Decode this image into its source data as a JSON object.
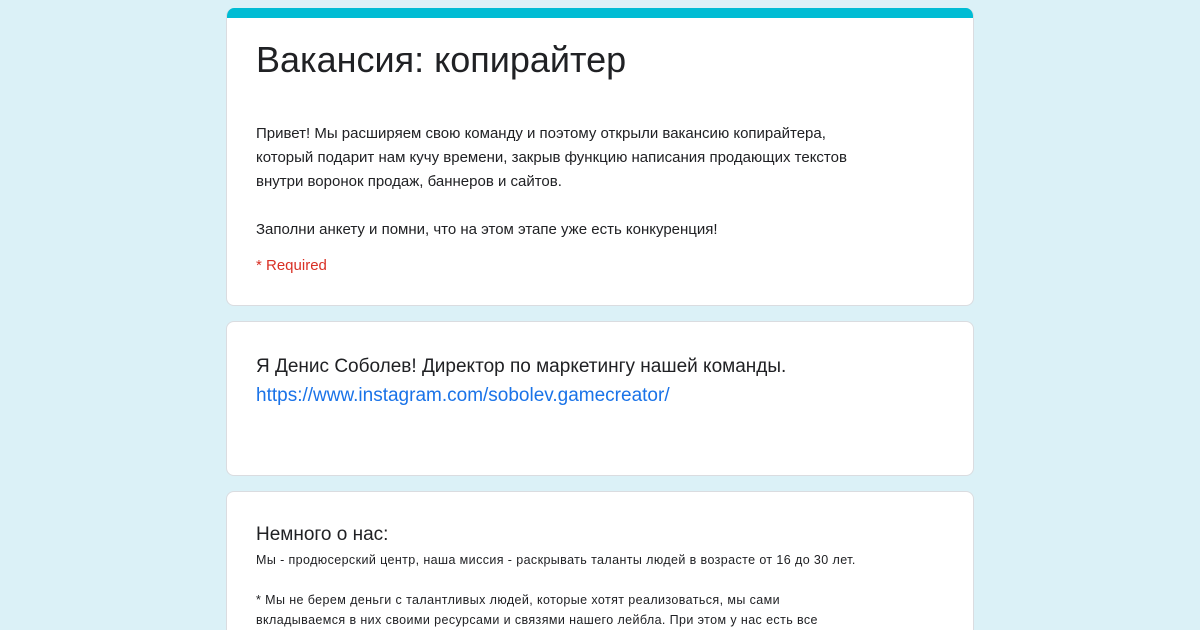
{
  "header": {
    "title": "Вакансия: копирайтер",
    "description": "Привет! Мы расширяем свою команду и поэтому открыли вакансию копирайтера,\nкоторый подарит нам кучу времени, закрыв функцию написания продающих текстов\nвнутри воронок продаж, баннеров и сайтов.\n\nЗаполни анкету и помни, что на этом этапе уже есть конкуренция!",
    "required_note": "* Required"
  },
  "intro": {
    "text": "Я Денис Соболев! Директор по маркетингу нашей команды.",
    "link": "https://www.instagram.com/sobolev.gamecreator/"
  },
  "about": {
    "heading": "Немного о нас:",
    "text": "Мы - продюсерский центр, наша миссия - раскрывать таланты людей в возрасте от 16 до 30 лет.\n\n* Мы не берем деньги с талантливых людей, которые хотят реализоваться, мы сами\nвкладываемся в них своими ресурсами и связями нашего лейбла. При этом у нас есть все"
  },
  "colors": {
    "accent": "#00bcd4",
    "background": "#dbf1f7",
    "link": "#1a73e8",
    "required": "#d93025"
  }
}
